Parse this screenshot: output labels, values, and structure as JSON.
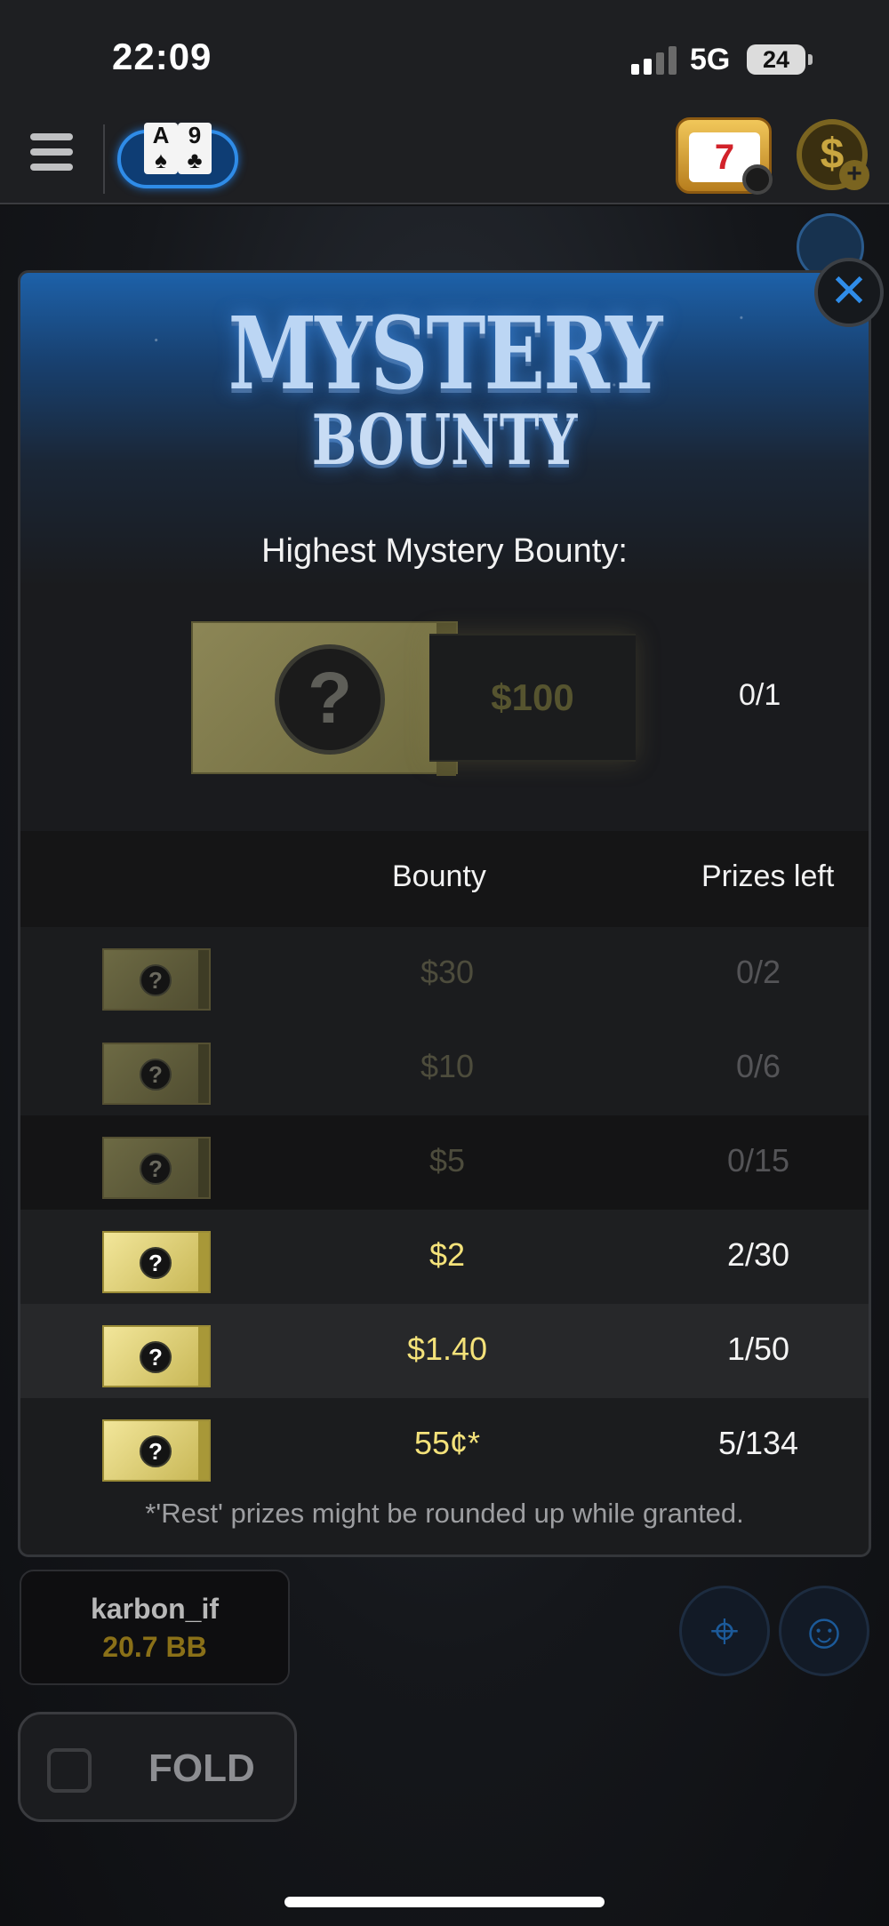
{
  "status": {
    "time": "22:09",
    "network": "5G",
    "battery": "24"
  },
  "nav": {
    "hand": {
      "card1_rank": "A",
      "card1_suit": "♠",
      "card2_rank": "9",
      "card2_suit": "♣"
    },
    "slots_symbol": "7",
    "cashier_symbol": "$"
  },
  "modal": {
    "title_line1": "MYSTERY",
    "title_line2": "BOUNTY",
    "highest_label": "Highest Mystery Bounty:",
    "highest": {
      "value": "$100",
      "prizes_left": "0/1"
    },
    "columns": {
      "bounty": "Bounty",
      "prizes_left": "Prizes left"
    },
    "rows": [
      {
        "bounty": "$30",
        "prizes": "0/2",
        "active": false
      },
      {
        "bounty": "$10",
        "prizes": "0/6",
        "active": false
      },
      {
        "bounty": "$5",
        "prizes": "0/15",
        "active": false
      },
      {
        "bounty": "$2",
        "prizes": "2/30",
        "active": true
      },
      {
        "bounty": "$1.40",
        "prizes": "1/50",
        "active": true
      },
      {
        "bounty": "55¢*",
        "prizes": "5/134",
        "active": true
      }
    ],
    "footnote": "*'Rest' prizes might be rounded up while granted.",
    "close_symbol": "✕",
    "ticket_symbol": "?"
  },
  "player": {
    "name": "karbon_if",
    "stack": "20.7 BB"
  },
  "actions": {
    "fold_label": "FOLD"
  },
  "colors": {
    "accent_blue": "#2f8ce8",
    "gold": "#f4e27a",
    "dim_gold": "#4d4c3c"
  }
}
